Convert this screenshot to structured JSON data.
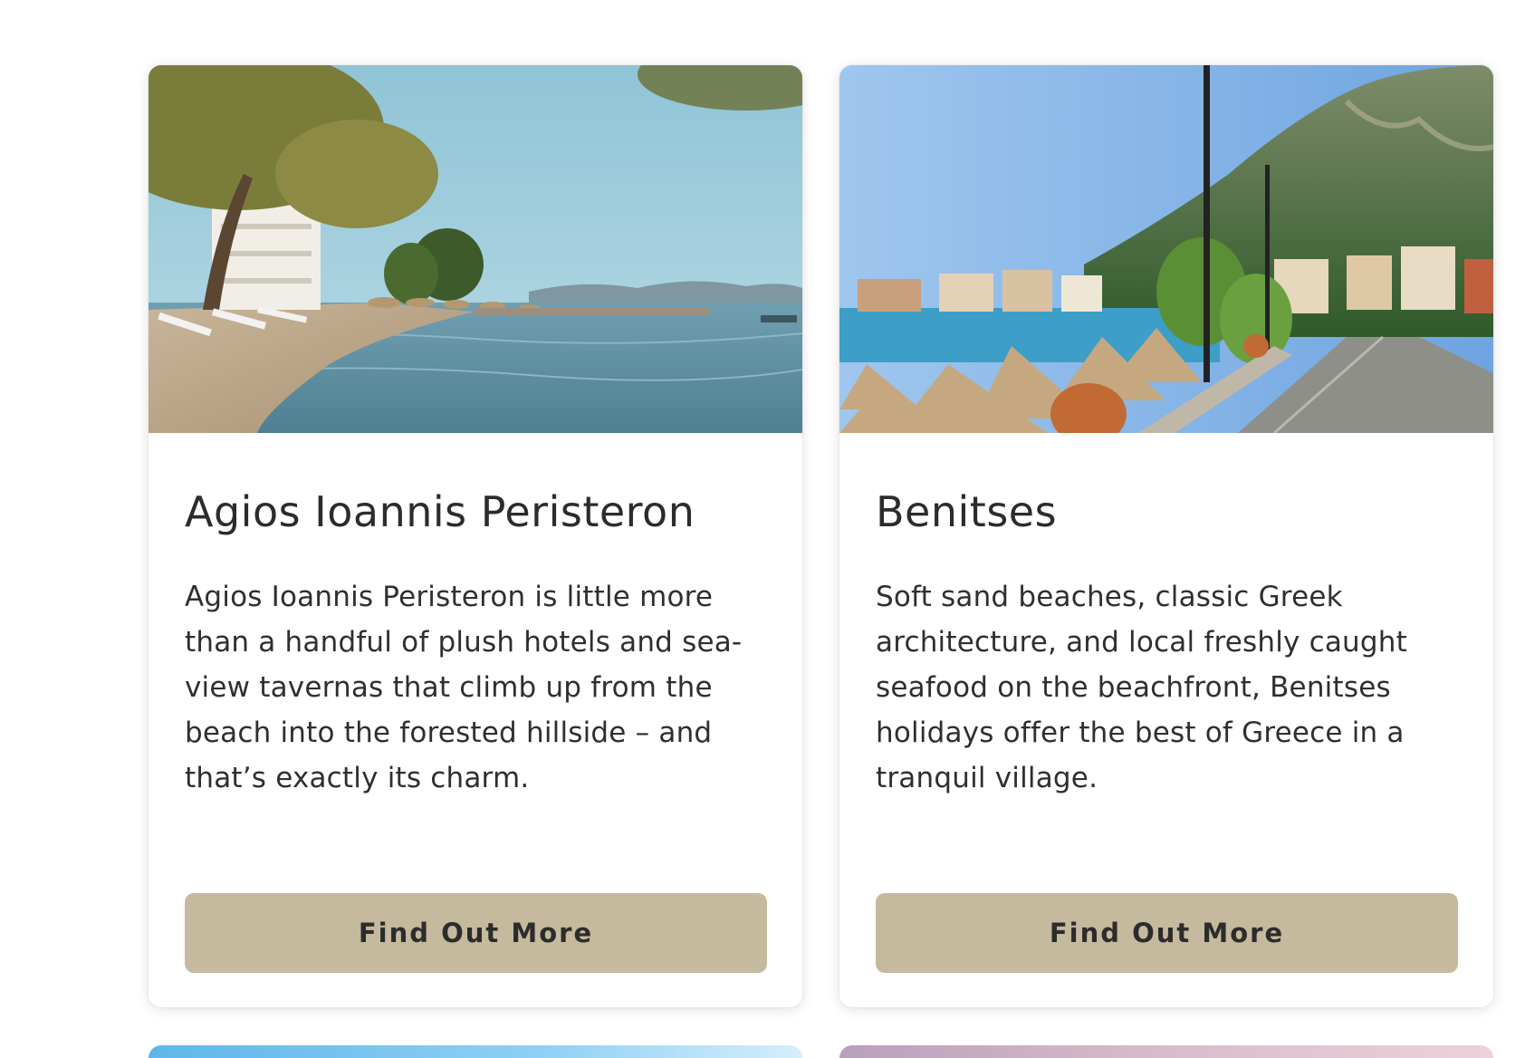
{
  "cards": [
    {
      "image_alt": "Agios Ioannis Peristeron beach with trees, sun loungers and calm sea",
      "title": "Agios Ioannis Peristeron",
      "description": "Agios Ioannis Peristeron is little more than a handful of plush hotels and sea-view tavernas that climb up from the beach into the forested hillside – and that’s exactly its charm.",
      "button_label": "Find Out More"
    },
    {
      "image_alt": "Benitses seafront promenade with thatched umbrellas, terracotta pot and green mountain",
      "title": "Benitses",
      "description": "Soft sand beaches, classic Greek architecture, and local freshly caught seafood on the beachfront, Benitses holidays offer the best of Greece in a tranquil village.",
      "button_label": "Find Out More"
    }
  ],
  "colors": {
    "button_background": "#c5b99e",
    "text": "#2c2c2c",
    "page_background": "#ffffff"
  }
}
